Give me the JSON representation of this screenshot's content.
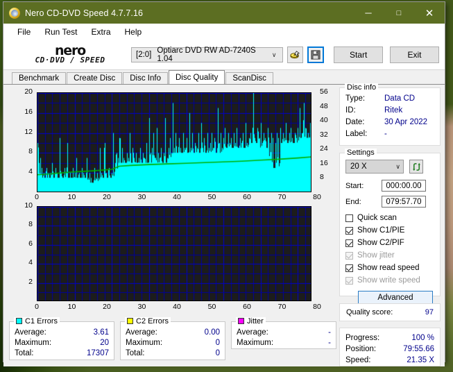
{
  "window": {
    "title": "Nero CD-DVD Speed 4.7.7.16",
    "minimize": "─",
    "maximize": "□",
    "close": "✕"
  },
  "menu": {
    "items": [
      "File",
      "Run Test",
      "Extra",
      "Help"
    ]
  },
  "logo": {
    "line1": "nero",
    "line2": "CD·DVD ∕ SPEED"
  },
  "toolbar": {
    "drive_id": "[2:0]",
    "drive_name": "Optiarc DVD RW AD-7240S 1.04",
    "caret": "∨",
    "eject_icon": "eject-disc-icon",
    "save_icon": "floppy-save-icon",
    "start_label": "Start",
    "exit_label": "Exit"
  },
  "tabs": {
    "items": [
      "Benchmark",
      "Create Disc",
      "Disc Info",
      "Disc Quality",
      "ScanDisc"
    ],
    "active": "Disc Quality"
  },
  "disc_info": {
    "legend": "Disc info",
    "rows": [
      {
        "key": "Type:",
        "value": "Data CD"
      },
      {
        "key": "ID:",
        "value": "Ritek"
      },
      {
        "key": "Date:",
        "value": "30 Apr 2022"
      },
      {
        "key": "Label:",
        "value": "-"
      }
    ]
  },
  "settings": {
    "legend": "Settings",
    "speed": "20 X",
    "speed_caret": "∨",
    "refresh_icon": "refresh-arrows-icon",
    "start_label": "Start:",
    "start_value": "000:00.00",
    "end_label": "End:",
    "end_value": "079:57.70",
    "checkboxes": [
      {
        "label": "Quick scan",
        "checked": false,
        "disabled": false
      },
      {
        "label": "Show C1/PIE",
        "checked": true,
        "disabled": false
      },
      {
        "label": "Show C2/PIF",
        "checked": true,
        "disabled": false
      },
      {
        "label": "Show jitter",
        "checked": true,
        "disabled": true
      },
      {
        "label": "Show read speed",
        "checked": true,
        "disabled": false
      },
      {
        "label": "Show write speed",
        "checked": true,
        "disabled": true
      }
    ],
    "advanced_label": "Advanced"
  },
  "quality": {
    "label": "Quality score:",
    "value": "97"
  },
  "progress": {
    "rows": [
      {
        "key": "Progress:",
        "value": "100 %"
      },
      {
        "key": "Position:",
        "value": "79:55.66"
      },
      {
        "key": "Speed:",
        "value": "21.35 X"
      }
    ]
  },
  "stats": {
    "c1": {
      "legend": "C1 Errors",
      "color": "#00ffff",
      "rows": [
        {
          "key": "Average:",
          "value": "3.61"
        },
        {
          "key": "Maximum:",
          "value": "20"
        },
        {
          "key": "Total:",
          "value": "17307"
        }
      ]
    },
    "c2": {
      "legend": "C2 Errors",
      "color": "#ffff00",
      "rows": [
        {
          "key": "Average:",
          "value": "0.00"
        },
        {
          "key": "Maximum:",
          "value": "0"
        },
        {
          "key": "Total:",
          "value": "0"
        }
      ]
    },
    "jitter": {
      "legend": "Jitter",
      "color": "#ff00ff",
      "rows": [
        {
          "key": "Average:",
          "value": "-"
        },
        {
          "key": "Maximum:",
          "value": "-"
        }
      ]
    }
  },
  "chart_data": [
    {
      "type": "area",
      "name": "c1-errors-chart",
      "title": "C1 Errors vs position",
      "xlabel": "",
      "ylabel": "",
      "xlim": [
        0,
        80
      ],
      "ylim": [
        0,
        20
      ],
      "y2lim": [
        0,
        56
      ],
      "grid": true,
      "xticks": [
        0,
        10,
        20,
        30,
        40,
        50,
        60,
        70,
        80
      ],
      "yticks": [
        4,
        8,
        12,
        16,
        20
      ],
      "y2ticks": [
        8,
        16,
        24,
        32,
        40,
        48,
        56
      ],
      "bg": "#1c1c1c",
      "gridcolor": "#0000cd",
      "series": [
        {
          "name": "C1 errors",
          "color": "#00ffff",
          "kind": "area-spikes",
          "x": [
            0,
            0.4,
            0.8,
            1.2,
            1.6,
            2,
            2.4,
            2.8,
            3.2,
            3.6,
            4,
            4.4,
            4.8,
            5.2,
            5.6,
            6,
            6.4,
            6.8,
            7.2,
            7.6,
            8,
            8.4,
            8.8,
            9.2,
            9.6,
            10,
            10.4,
            10.8,
            11.2,
            11.6,
            12,
            12.4,
            12.8,
            13.2,
            13.6,
            14,
            14.4,
            14.8,
            15.2,
            15.6,
            16,
            16.4,
            16.8,
            17.2,
            17.6,
            18,
            18.4,
            18.8,
            19.2,
            19.6,
            20,
            20.4,
            20.8,
            21.2,
            21.6,
            22,
            22.4,
            22.8,
            23.2,
            23.6,
            24,
            24.4,
            24.8,
            25.2,
            25.6,
            26,
            26.4,
            26.8,
            27.2,
            27.6,
            28,
            28.4,
            28.8,
            29.2,
            29.6,
            30,
            30.4,
            30.8,
            31.2,
            31.6,
            32,
            32.4,
            32.8,
            33.2,
            33.6,
            34,
            34.4,
            34.8,
            35.2,
            35.6,
            36,
            36.4,
            36.8,
            37.2,
            37.6,
            38,
            38.4,
            38.8,
            39.2,
            39.6,
            40,
            40.4,
            40.8,
            41.2,
            41.6,
            42,
            42.4,
            42.8,
            43.2,
            43.6,
            44,
            44.4,
            44.8,
            45.2,
            45.6,
            46,
            46.4,
            46.8,
            47.2,
            47.6,
            48,
            48.4,
            48.8,
            49.2,
            49.6,
            50,
            50.4,
            50.8,
            51.2,
            51.6,
            52,
            52.4,
            52.8,
            53.2,
            53.6,
            54,
            54.4,
            54.8,
            55.2,
            55.6,
            56,
            56.4,
            56.8,
            57.2,
            57.6,
            58,
            58.4,
            58.8,
            59.2,
            59.6,
            60,
            60.4,
            60.8,
            61.2,
            61.6,
            62,
            62.4,
            62.8,
            63.2,
            63.6,
            64,
            64.4,
            64.8,
            65.2,
            65.6,
            66,
            66.4,
            66.8,
            67.2,
            67.6,
            68,
            68.4,
            68.8,
            69.2,
            69.6,
            70,
            70.4,
            70.8,
            71.2,
            71.6,
            72,
            72.4,
            72.8,
            73.2,
            73.6,
            74,
            74.4,
            74.8,
            75.2,
            75.6,
            76,
            76.4,
            76.8,
            77.2,
            77.6,
            78,
            78.4,
            78.8,
            79.2,
            79.6,
            80
          ],
          "y": [
            10,
            6,
            7,
            5,
            4,
            3,
            5,
            4,
            3,
            4,
            6,
            3,
            5,
            4,
            3,
            11,
            4,
            3,
            5,
            4,
            10,
            3,
            4,
            3,
            5,
            4,
            7,
            3,
            4,
            3,
            5,
            4,
            3,
            7,
            3,
            4,
            3,
            2,
            5,
            3,
            4,
            3,
            9,
            4,
            3,
            10,
            4,
            3,
            5,
            3,
            4,
            12,
            6,
            8,
            7,
            11,
            6,
            9,
            7,
            6,
            8,
            7,
            12,
            6,
            9,
            7,
            8,
            6,
            7,
            9,
            6,
            8,
            7,
            10,
            6,
            15,
            8,
            9,
            12,
            7,
            13,
            8,
            7,
            9,
            6,
            8,
            15,
            7,
            9,
            11,
            8,
            18,
            9,
            12,
            8,
            11,
            9,
            8,
            12,
            9,
            11,
            8,
            16,
            9,
            12,
            8,
            10,
            9,
            12,
            8,
            14,
            9,
            11,
            8,
            12,
            9,
            10,
            12,
            9,
            11,
            8,
            17,
            10,
            12,
            9,
            11,
            13,
            9,
            12,
            10,
            11,
            9,
            12,
            10,
            13,
            9,
            11,
            10,
            12,
            9,
            14,
            10,
            11,
            12,
            10,
            20,
            11,
            10,
            13,
            11,
            14,
            10,
            12,
            11,
            9,
            13,
            10,
            12,
            11,
            5,
            10,
            12,
            11,
            13,
            10,
            12,
            11,
            14,
            10,
            12,
            13,
            11,
            10,
            12,
            11,
            13,
            17,
            11,
            12,
            18,
            13,
            11,
            12,
            14,
            11,
            13,
            12,
            15,
            11,
            16,
            13,
            12,
            14,
            20,
            13,
            12,
            14,
            13
          ]
        },
        {
          "name": "Read speed",
          "color": "#00b000",
          "kind": "line",
          "axis": "y2",
          "x": [
            0,
            5,
            10,
            15,
            20,
            22,
            25,
            30,
            35,
            40,
            45,
            50,
            55,
            60,
            65,
            70,
            75,
            80
          ],
          "y": [
            10.2,
            11.0,
            11.8,
            12.4,
            13.2,
            15.0,
            15.4,
            15.9,
            16.3,
            16.6,
            17.0,
            17.4,
            17.8,
            18.4,
            18.9,
            19.6,
            20.4,
            21.35
          ]
        }
      ]
    },
    {
      "type": "area",
      "name": "c2-errors-chart",
      "title": "C2 Errors vs position",
      "xlabel": "",
      "ylabel": "",
      "xlim": [
        0,
        80
      ],
      "ylim": [
        0,
        10
      ],
      "grid": true,
      "xticks": [
        0,
        10,
        20,
        30,
        40,
        50,
        60,
        70,
        80
      ],
      "yticks": [
        2,
        4,
        6,
        8,
        10
      ],
      "bg": "#1c1c1c",
      "gridcolor": "#0000cd",
      "series": [
        {
          "name": "C2 errors",
          "color": "#ffff00",
          "kind": "area-spikes",
          "x": [],
          "y": []
        }
      ]
    }
  ]
}
